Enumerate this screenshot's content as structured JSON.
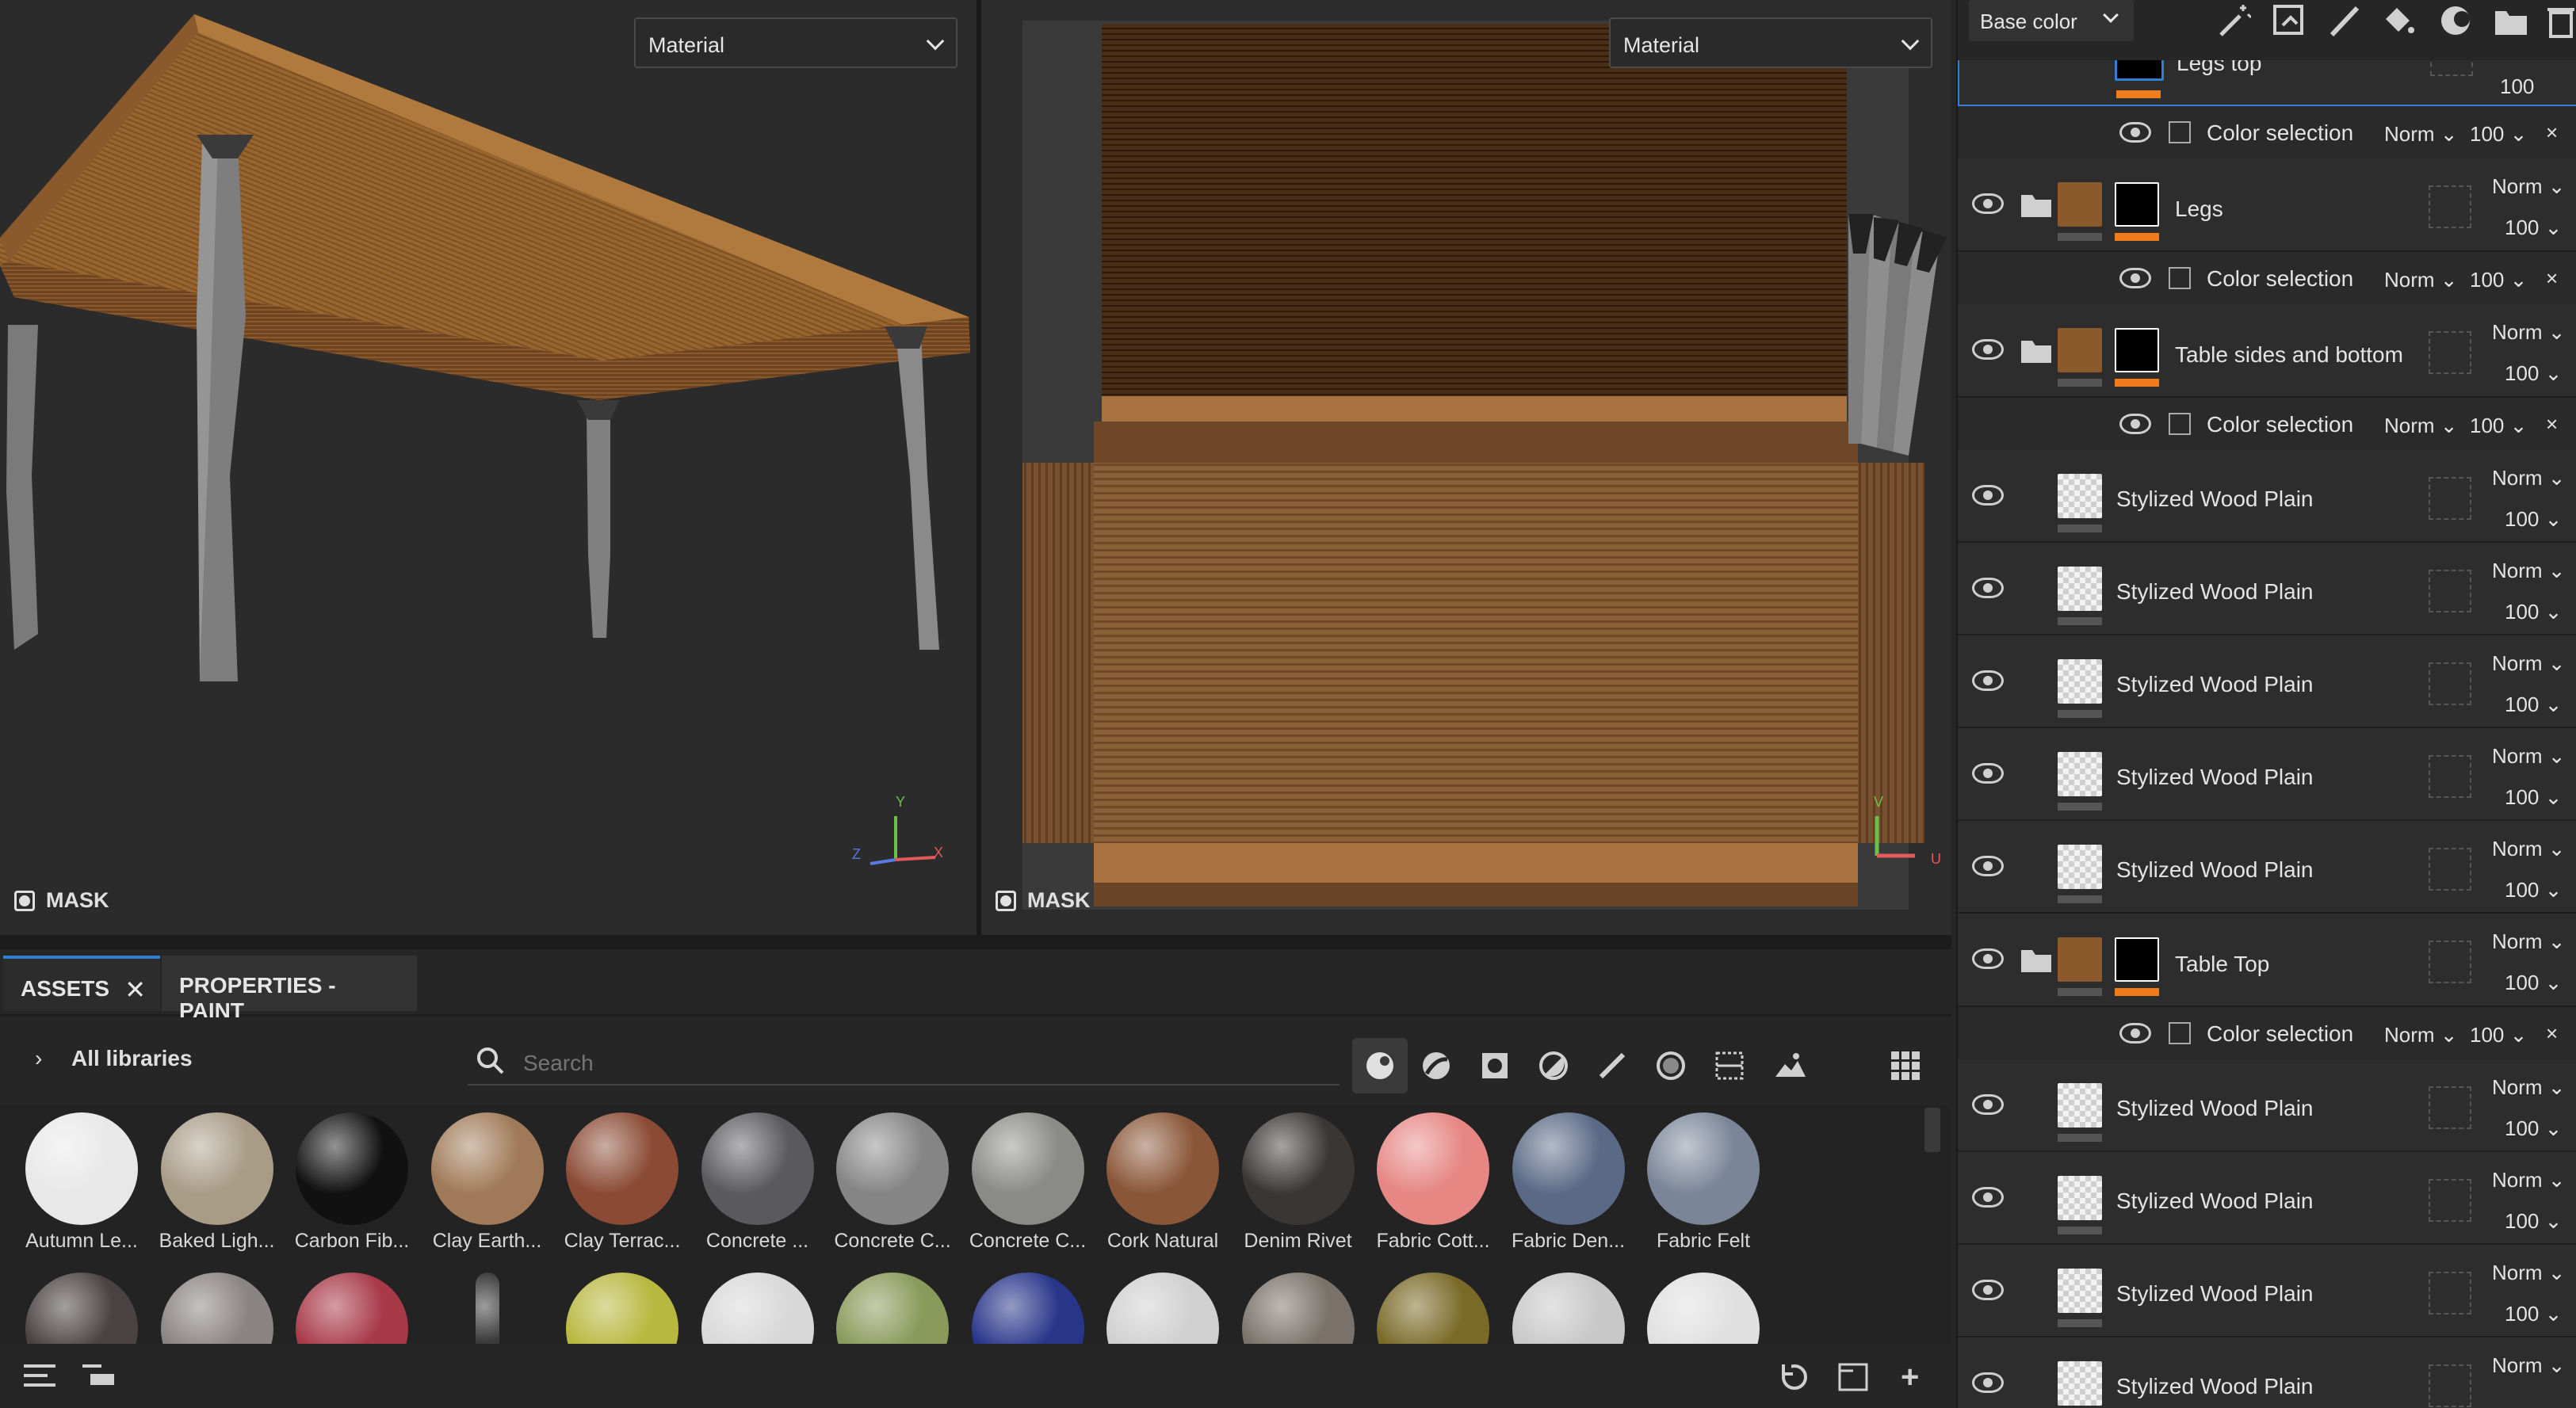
{
  "viewport3d": {
    "mode": "Material",
    "mask_label": "MASK"
  },
  "viewport2d": {
    "mode": "Material",
    "mask_label": "MASK"
  },
  "assets": {
    "tab_assets": "ASSETS",
    "tab_properties": "PROPERTIES - PAINT",
    "library": "All libraries",
    "search_placeholder": "Search",
    "materials": [
      {
        "name": "Autumn Le...",
        "color": "#e8e8e8"
      },
      {
        "name": "Baked Ligh...",
        "color": "#a99c87"
      },
      {
        "name": "Carbon Fib...",
        "color": "#111111"
      },
      {
        "name": "Clay Earth...",
        "color": "#a07a58"
      },
      {
        "name": "Clay Terrac...",
        "color": "#8a4a34"
      },
      {
        "name": "Concrete ...",
        "color": "#5a5a5e"
      },
      {
        "name": "Concrete C...",
        "color": "#858585"
      },
      {
        "name": "Concrete C...",
        "color": "#8a8a86"
      },
      {
        "name": "Cork Natural",
        "color": "#8a5638"
      },
      {
        "name": "Denim Rivet",
        "color": "#3a3634"
      },
      {
        "name": "Fabric Cott...",
        "color": "#e68784"
      },
      {
        "name": "Fabric Den...",
        "color": "#5a6a86"
      },
      {
        "name": "Fabric Felt",
        "color": "#7a8698"
      }
    ],
    "row2_colors": [
      "#4a4242",
      "#8a8482",
      "#a83a48",
      "#3a3a3a",
      "#b8b840",
      "#d8d8d8",
      "#8a9a5a",
      "#28368a",
      "#d0d0d0",
      "#7a726a",
      "#7a6a28",
      "#c8c8c8",
      "#e0e0e0"
    ]
  },
  "layers": {
    "channel": "Base color",
    "items": [
      {
        "type": "partial-top",
        "name": "Legs top",
        "value": "100"
      },
      {
        "type": "mask",
        "name": "Color selection",
        "blend": "Norm",
        "opacity": "100"
      },
      {
        "type": "folder",
        "name": "Legs",
        "blend": "Norm",
        "opacity": "100"
      },
      {
        "type": "mask",
        "name": "Color selection",
        "blend": "Norm",
        "opacity": "100"
      },
      {
        "type": "folder",
        "name": "Table sides and bottom",
        "blend": "Norm",
        "opacity": "100"
      },
      {
        "type": "mask",
        "name": "Color selection",
        "blend": "Norm",
        "opacity": "100"
      },
      {
        "type": "fill",
        "name": "Stylized Wood Plain",
        "blend": "Norm",
        "opacity": "100"
      },
      {
        "type": "fill",
        "name": "Stylized Wood Plain",
        "blend": "Norm",
        "opacity": "100"
      },
      {
        "type": "fill",
        "name": "Stylized Wood Plain",
        "blend": "Norm",
        "opacity": "100"
      },
      {
        "type": "fill",
        "name": "Stylized Wood Plain",
        "blend": "Norm",
        "opacity": "100"
      },
      {
        "type": "fill",
        "name": "Stylized Wood Plain",
        "blend": "Norm",
        "opacity": "100"
      },
      {
        "type": "folder",
        "name": "Table Top",
        "blend": "Norm",
        "opacity": "100"
      },
      {
        "type": "mask",
        "name": "Color selection",
        "blend": "Norm",
        "opacity": "100"
      },
      {
        "type": "fill",
        "name": "Stylized Wood Plain",
        "blend": "Norm",
        "opacity": "100"
      },
      {
        "type": "fill",
        "name": "Stylized Wood Plain",
        "blend": "Norm",
        "opacity": "100"
      },
      {
        "type": "fill",
        "name": "Stylized Wood Plain",
        "blend": "Norm",
        "opacity": "100"
      },
      {
        "type": "fill",
        "name": "Stylized Wood Plain",
        "blend": "Norm",
        "opacity": ""
      }
    ]
  },
  "axes3d": {
    "y": "Y",
    "z": "Z",
    "x": "X"
  },
  "axes2d": {
    "v": "V",
    "u": "U"
  }
}
